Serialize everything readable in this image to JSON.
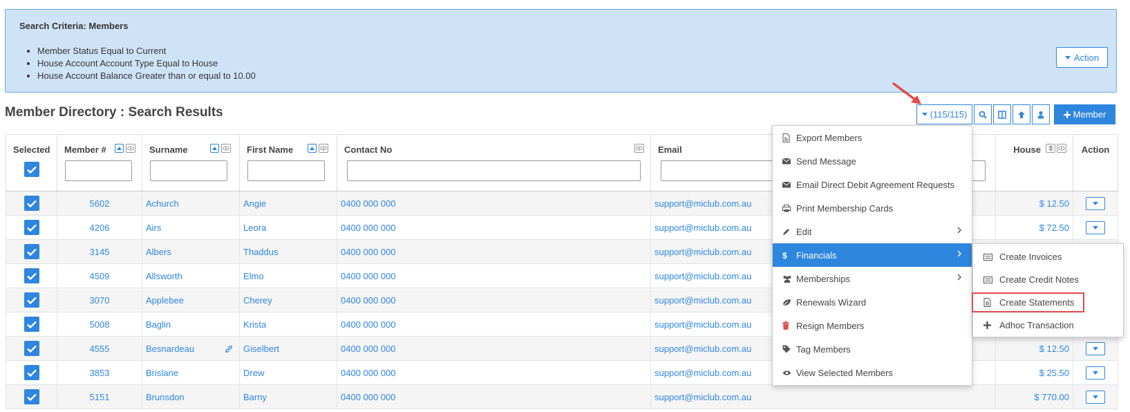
{
  "criteria": {
    "title": "Search Criteria: Members",
    "items": [
      "Member Status Equal to Current",
      "House Account Account Type Equal to House",
      "House Account Balance Greater than or equal to 10.00"
    ],
    "action_label": "Action"
  },
  "page_title": "Member Directory : Search Results",
  "toolbar": {
    "count_label": "(115/115)",
    "member_label": "Member"
  },
  "columns": {
    "selected": "Selected",
    "member_no": "Member #",
    "surname": "Surname",
    "first_name": "First Name",
    "contact": "Contact No",
    "email": "Email",
    "house": "House",
    "action": "Action"
  },
  "rows": [
    {
      "member_no": "5602",
      "surname": "Achurch",
      "first_name": "Angie",
      "contact": "0400 000 000",
      "email": "support@miclub.com.au",
      "house": "$ 12.50"
    },
    {
      "member_no": "4206",
      "surname": "Airs",
      "first_name": "Leora",
      "contact": "0400 000 000",
      "email": "support@miclub.com.au",
      "house": "$ 72.50"
    },
    {
      "member_no": "3145",
      "surname": "Albers",
      "first_name": "Thaddus",
      "contact": "0400 000 000",
      "email": "support@miclub.com.au",
      "house": ""
    },
    {
      "member_no": "4509",
      "surname": "Allsworth",
      "first_name": "Elmo",
      "contact": "0400 000 000",
      "email": "support@miclub.com.au",
      "house": ""
    },
    {
      "member_no": "3070",
      "surname": "Applebee",
      "first_name": "Cherey",
      "contact": "0400 000 000",
      "email": "support@miclub.com.au",
      "house": ""
    },
    {
      "member_no": "5008",
      "surname": "Baglin",
      "first_name": "Krista",
      "contact": "0400 000 000",
      "email": "support@miclub.com.au",
      "house": ""
    },
    {
      "member_no": "4555",
      "surname": "Besnardeau",
      "first_name": "Giselbert",
      "contact": "0400 000 000",
      "email": "support@miclub.com.au",
      "house": "$ 12.50"
    },
    {
      "member_no": "3853",
      "surname": "Brislane",
      "first_name": "Drew",
      "contact": "0400 000 000",
      "email": "support@miclub.com.au",
      "house": "$ 25.50"
    },
    {
      "member_no": "5151",
      "surname": "Brunsdon",
      "first_name": "Barny",
      "contact": "0400 000 000",
      "email": "support@miclub.com.au",
      "house": "$ 770.00"
    }
  ],
  "menu": {
    "items": [
      "Export Members",
      "Send Message",
      "Email Direct Debit Agreement Requests",
      "Print Membership Cards",
      "Edit",
      "Financials",
      "Memberships",
      "Renewals Wizard",
      "Resign Members",
      "Tag Members",
      "View Selected Members"
    ]
  },
  "submenu": {
    "items": [
      "Create Invoices",
      "Create Credit Notes",
      "Create Statements",
      "Adhoc Transaction"
    ]
  },
  "colors": {
    "accent": "#2e86de",
    "criteria_bg": "#cfe3f7",
    "money": "#b03030",
    "highlight": "#e24a4a"
  }
}
